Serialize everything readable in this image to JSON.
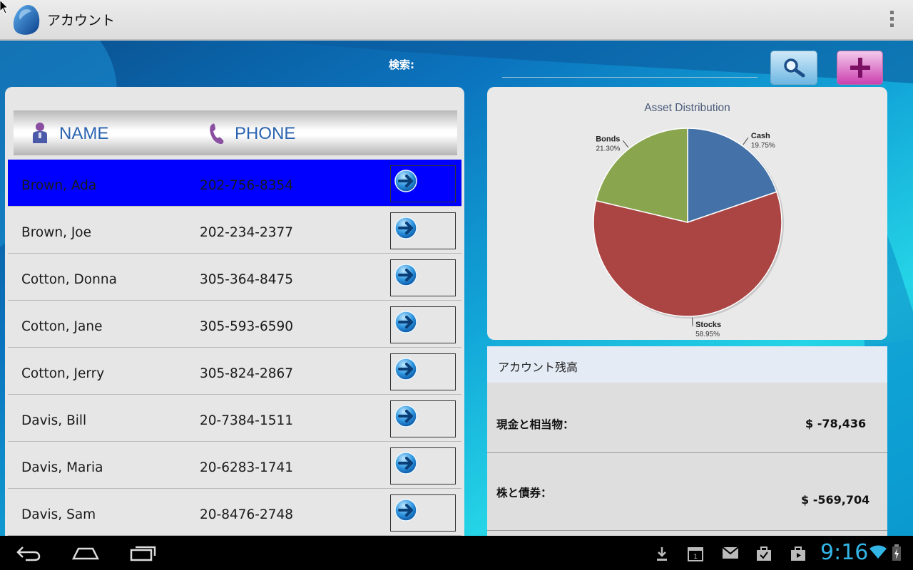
{
  "app": {
    "title": "アカウント"
  },
  "search": {
    "label": "検索:",
    "value": "",
    "placeholder": ""
  },
  "list": {
    "header_name": "NAME",
    "header_phone": "PHONE",
    "rows": [
      {
        "name": "Brown, Ada",
        "phone": "202-756-8354",
        "selected": true
      },
      {
        "name": "Brown, Joe",
        "phone": "202-234-2377"
      },
      {
        "name": "Cotton, Donna",
        "phone": "305-364-8475"
      },
      {
        "name": "Cotton, Jane",
        "phone": "305-593-6590"
      },
      {
        "name": "Cotton, Jerry",
        "phone": "305-824-2867"
      },
      {
        "name": "Davis, Bill",
        "phone": "20-7384-1511"
      },
      {
        "name": "Davis, Maria",
        "phone": "20-6283-1741"
      },
      {
        "name": "Davis, Sam",
        "phone": "20-8476-2748"
      }
    ]
  },
  "chart_data": {
    "type": "pie",
    "title": "Asset Distribution",
    "slices": [
      {
        "label": "Cash",
        "percent_label": "19.75%",
        "value": 19.75,
        "color": "#4472a8"
      },
      {
        "label": "Stocks",
        "percent_label": "58.95%",
        "value": 58.95,
        "color": "#aa4543"
      },
      {
        "label": "Bonds",
        "percent_label": "21.30%",
        "value": 21.3,
        "color": "#89a54e"
      }
    ]
  },
  "balance": {
    "title": "アカウント残高",
    "rows": [
      {
        "label": "現金と相当物：",
        "value": "$  -78,436"
      },
      {
        "label": "株と債券：",
        "value": "$ -569,704"
      }
    ]
  },
  "status": {
    "time": "9:16"
  },
  "colors": {
    "selected_row": "#0000ff",
    "clock": "#33b5e5"
  }
}
